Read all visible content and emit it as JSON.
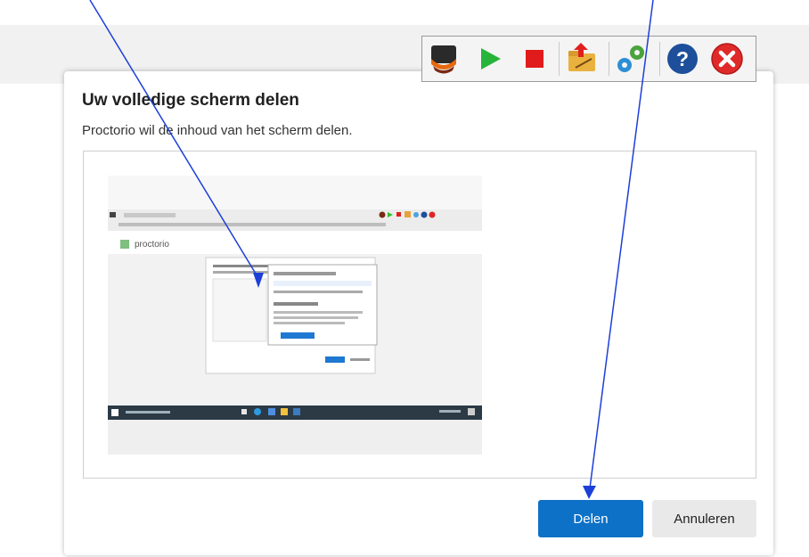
{
  "dialog": {
    "title": "Uw volledige scherm delen",
    "subtitle": "Proctorio wil de inhoud van het scherm delen.",
    "share_button": "Delen",
    "cancel_button": "Annuleren"
  },
  "preview": {
    "logo_text": "proctorio"
  },
  "toolbar": {
    "icons": [
      "webcam-icon",
      "play-icon",
      "stop-icon",
      "folder-upload-icon",
      "settings-gears-icon",
      "help-icon",
      "close-icon"
    ]
  },
  "colors": {
    "primary": "#0d71c7",
    "annotation": "#1c3fd8",
    "taskbar": "#2b3a45"
  }
}
